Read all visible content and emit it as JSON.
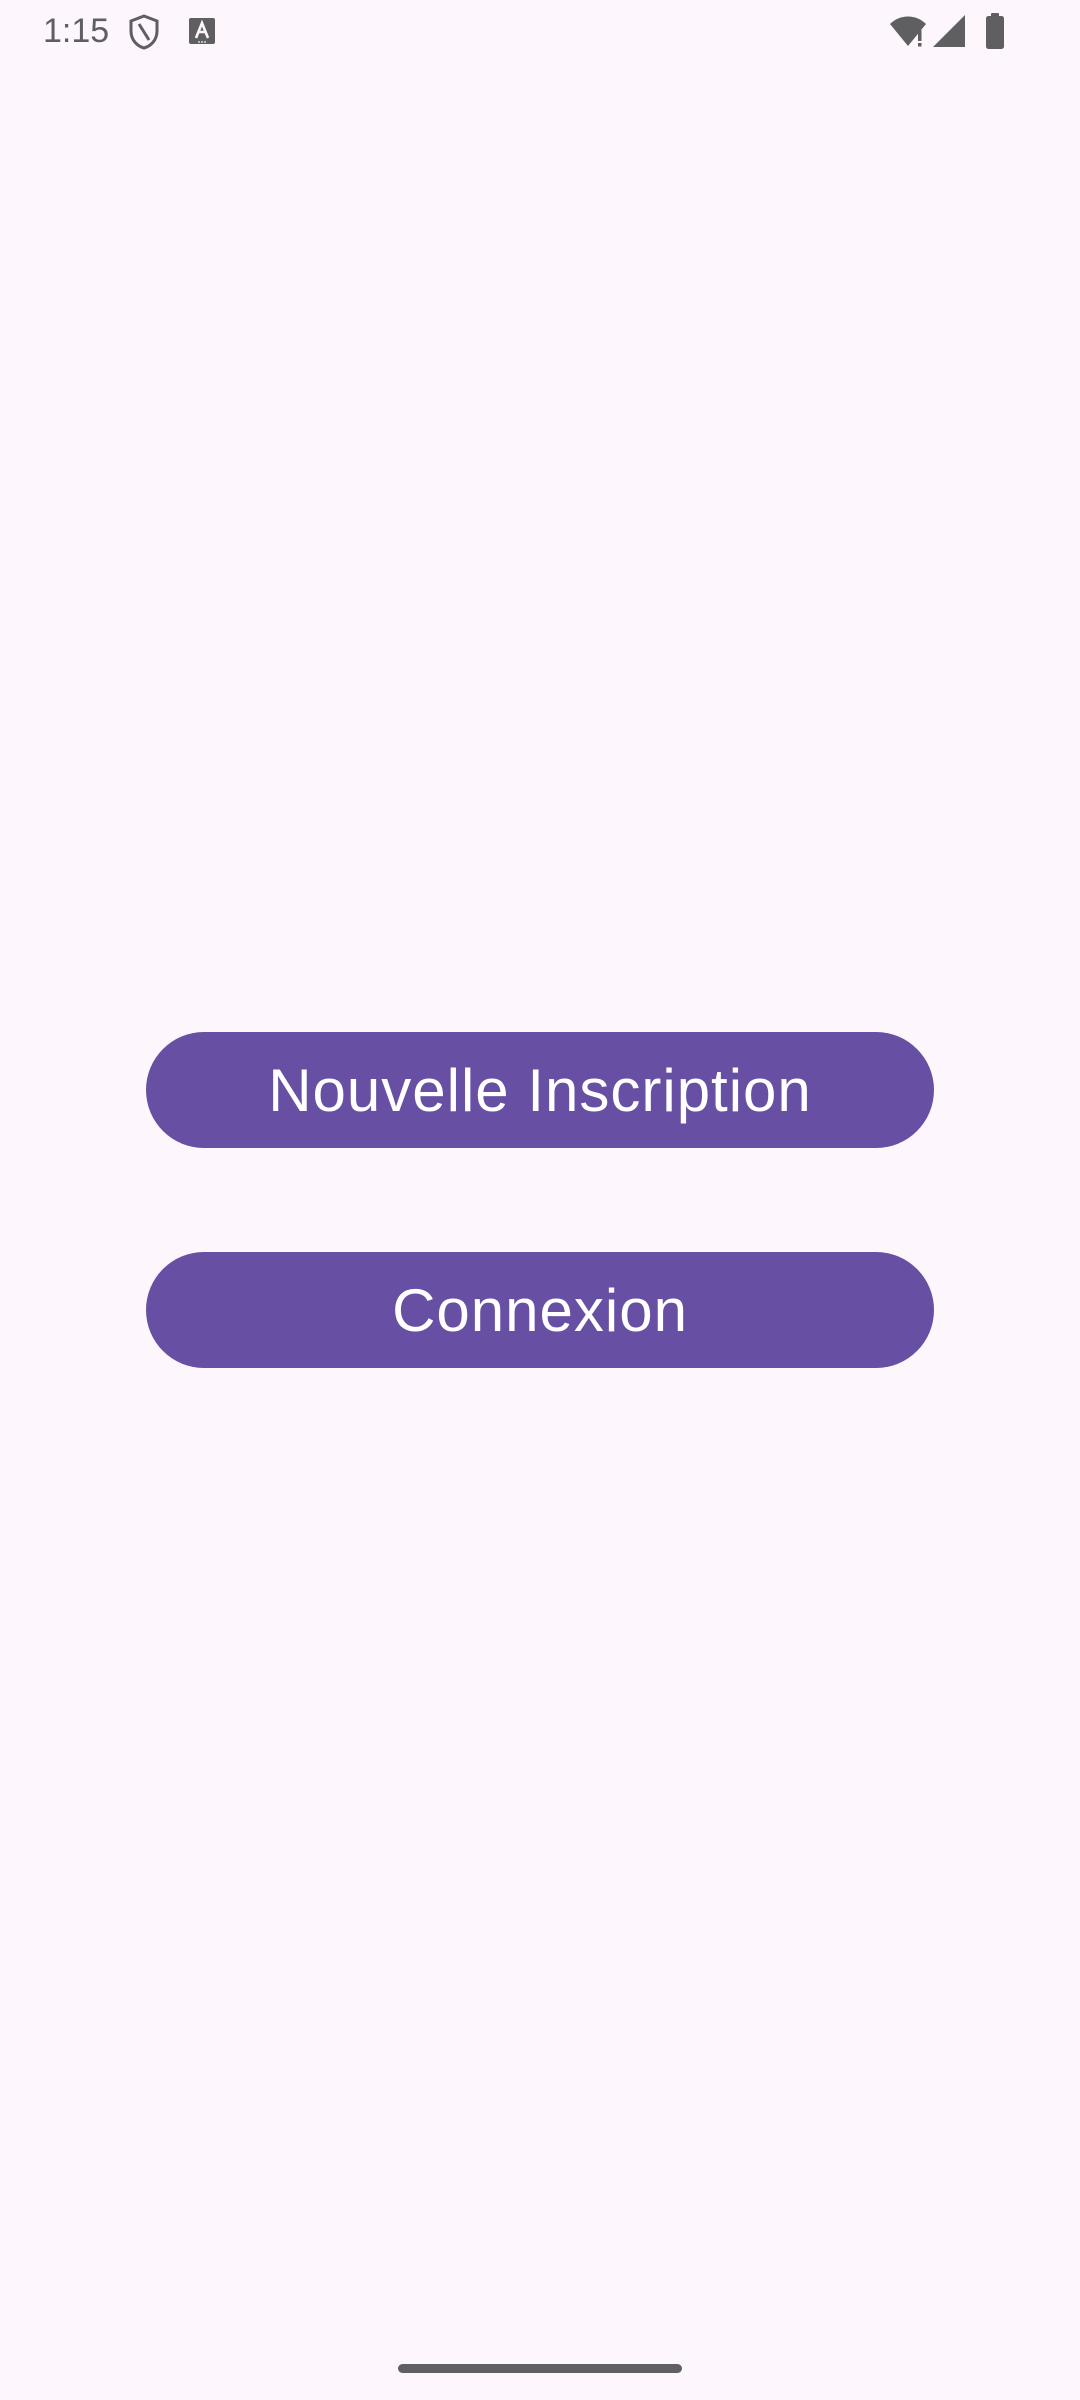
{
  "status_bar": {
    "time": "1:15",
    "icons": [
      "shield-icon",
      "keyboard-icon",
      "wifi-icon",
      "signal-icon",
      "battery-icon"
    ]
  },
  "main": {
    "signup_label": "Nouvelle Inscription",
    "login_label": "Connexion"
  },
  "colors": {
    "background": "#FDF6FD",
    "button": "#6750A4",
    "button_text": "#FFFFFF",
    "status_icons": "#5F5F62"
  }
}
